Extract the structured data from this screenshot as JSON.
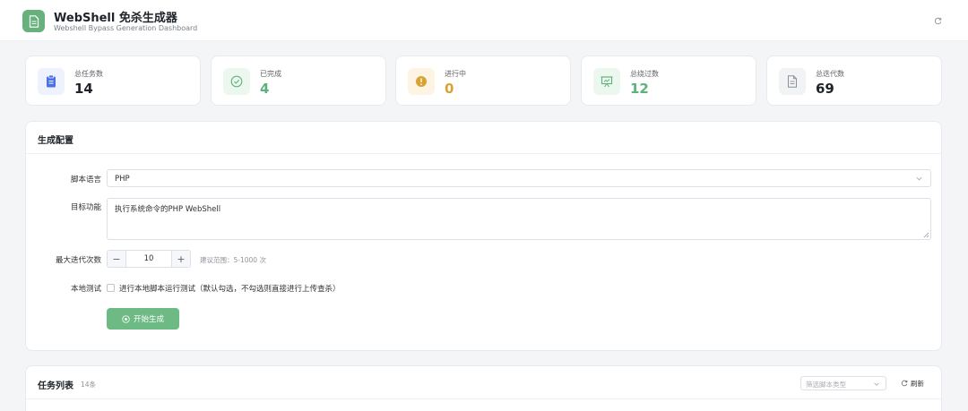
{
  "header": {
    "title": "WebShell 免杀生成器",
    "subtitle": "Webshell Bypass Generation Dashboard",
    "logo_icon": "document-icon",
    "refresh_icon": "refresh-icon"
  },
  "stats": [
    {
      "label": "总任务数",
      "value": "14",
      "icon": "clipboard-icon",
      "color": "#4a72e8",
      "bg": "#eef2fd"
    },
    {
      "label": "已完成",
      "value": "4",
      "icon": "check-circle-icon",
      "color": "#5cb27a",
      "bg": "#ecf7ef"
    },
    {
      "label": "进行中",
      "value": "0",
      "icon": "warning-circle-icon",
      "color": "#d9a233",
      "bg": "#fdf4e4"
    },
    {
      "label": "总绕过数",
      "value": "12",
      "icon": "presentation-icon",
      "color": "#5cb27a",
      "bg": "#ecf7ef"
    },
    {
      "label": "总迭代数",
      "value": "69",
      "icon": "document-icon",
      "color": "#1f2329",
      "bg": "#f2f3f5"
    }
  ],
  "config": {
    "title": "生成配置",
    "language_label": "脚本语言",
    "language_value": "PHP",
    "function_label": "目标功能",
    "function_value": "执行系统命令的PHP WebShell",
    "iterations_label": "最大迭代次数",
    "iterations_value": "10",
    "iterations_minus": "−",
    "iterations_plus": "+",
    "iterations_hint": "建议范围：5-1000 次",
    "local_test_label": "本地测试",
    "local_test_text": "进行本地脚本运行测试（默认勾选，不勾选则直接进行上传查杀）",
    "generate_label": "开始生成"
  },
  "tasks": {
    "title": "任务列表",
    "count": "14条",
    "filter_placeholder": "筛选脚本类型",
    "refresh_label": "刷新"
  },
  "colors": {
    "accent": "#6dba84",
    "background": "#f4f5f7"
  }
}
